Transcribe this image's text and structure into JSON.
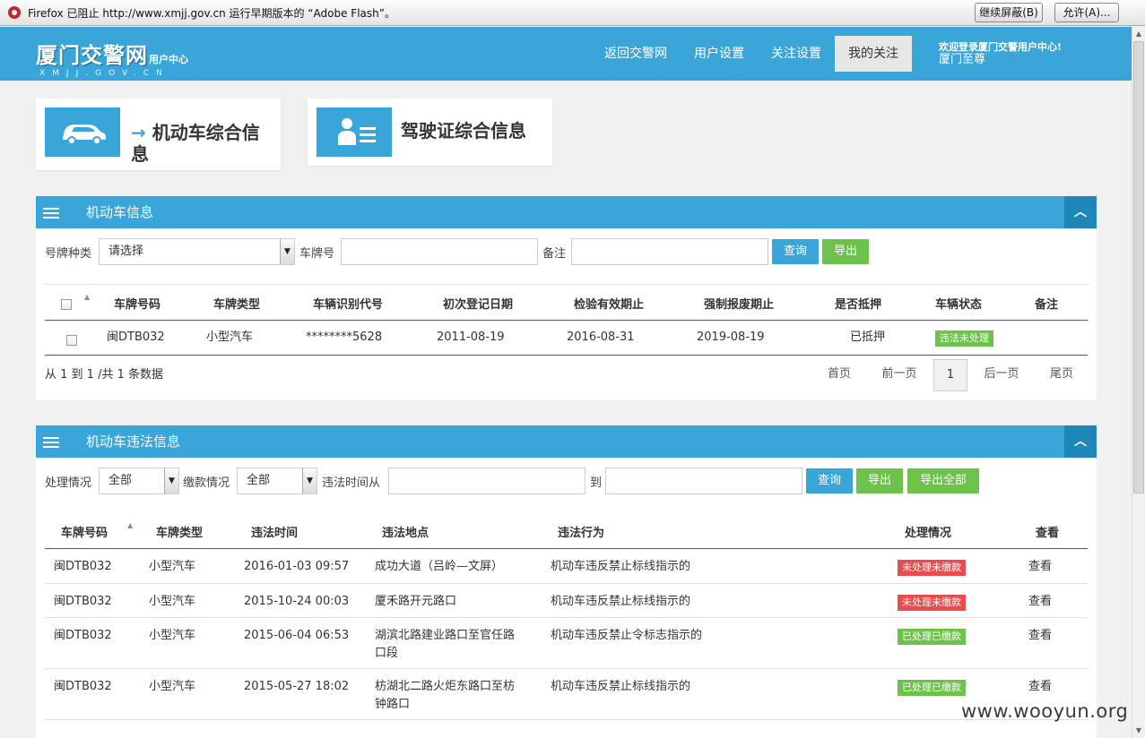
{
  "flashbar": {
    "message": "Firefox 已阻止 http://www.xmjj.gov.cn 运行早期版本的 “Adobe Flash”。",
    "continue_block": "继续屏蔽(B)",
    "allow": "允许(A)..."
  },
  "header": {
    "logo_main": "厦门交警网",
    "logo_small": "用户中心",
    "logo_sub": "XMJJ.GOV.CN",
    "nav": [
      "返回交警网",
      "用户设置",
      "关注设置",
      "我的关注"
    ],
    "welcome_line1": "欢迎登录厦门交警用户中心!",
    "welcome_line2": "厦门至尊"
  },
  "cards": {
    "vehicle_arrow": "→",
    "vehicle": "机动车综合信",
    "vehicle_wrap": "息",
    "license": "驾驶证综合信息"
  },
  "vehicle_panel": {
    "title": "机动车信息",
    "filter": {
      "plate_type_label": "号牌种类",
      "plate_type_value": "请选择",
      "plate_no_label": "车牌号",
      "remark_label": "备注",
      "query": "查询",
      "export": "导出"
    },
    "columns": [
      "车牌号码",
      "车牌类型",
      "车辆识别代号",
      "初次登记日期",
      "检验有效期止",
      "强制报废期止",
      "是否抵押",
      "车辆状态",
      "备注"
    ],
    "rows": [
      {
        "plate": "闽DTB032",
        "type": "小型汽车",
        "vin": "********5628",
        "reg_date": "2011-08-19",
        "inspect_until": "2016-08-31",
        "scrap_until": "2019-08-19",
        "mortgage": "已抵押",
        "status": "违法未处理",
        "remark": ""
      }
    ],
    "summary": "从 1 到 1 /共 1 条数据",
    "pager": {
      "first": "首页",
      "prev": "前一页",
      "current": "1",
      "next": "后一页",
      "last": "尾页"
    }
  },
  "violation_panel": {
    "title": "机动车违法信息",
    "filter": {
      "handle_label": "处理情况",
      "handle_value": "全部",
      "pay_label": "缴款情况",
      "pay_value": "全部",
      "time_from_label": "违法时间从",
      "to_label": "到",
      "query": "查询",
      "export": "导出",
      "export_all": "导出全部"
    },
    "columns": [
      "车牌号码",
      "车牌类型",
      "违法时间",
      "违法地点",
      "违法行为",
      "处理情况",
      "查看"
    ],
    "rows": [
      {
        "plate": "闽DTB032",
        "type": "小型汽车",
        "time": "2016-01-03 09:57",
        "place": "成功大道（吕岭—文屏）",
        "place2": "",
        "action": "机动车违反禁止标线指示的",
        "status": "未处理未缴款",
        "status_color": "#e84c4c",
        "view": "查看"
      },
      {
        "plate": "闽DTB032",
        "type": "小型汽车",
        "time": "2015-10-24 00:03",
        "place": "厦禾路开元路口",
        "place2": "",
        "action": "机动车违反禁止标线指示的",
        "status": "未处理未缴款",
        "status_color": "#e84c4c",
        "view": "查看"
      },
      {
        "plate": "闽DTB032",
        "type": "小型汽车",
        "time": "2015-06-04 06:53",
        "place": "湖滨北路建业路口至官任路",
        "place2": "口段",
        "action": "机动车违反禁止令标志指示的",
        "status": "已处理已缴款",
        "status_color": "#6cc24a",
        "view": "查看"
      },
      {
        "plate": "闽DTB032",
        "type": "小型汽车",
        "time": "2015-05-27 18:02",
        "place": "枋湖北二路火炬东路口至枋",
        "place2": "钟路口",
        "action": "机动车违反禁止标线指示的",
        "status": "已处理已缴款",
        "status_color": "#6cc24a",
        "view": "查看"
      }
    ]
  },
  "watermark": "www.wooyun.org",
  "colors": {
    "brand": "#3aa5d8",
    "brand_dark": "#1f86b9",
    "success": "#6cc24a",
    "danger": "#e84c4c"
  }
}
